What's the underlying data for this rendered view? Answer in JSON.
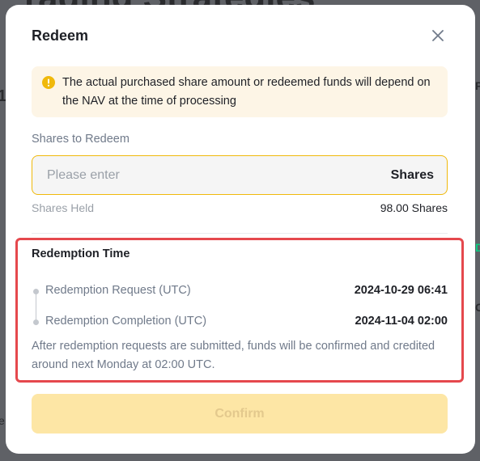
{
  "background": {
    "title_fragment": "rading Strategies",
    "left_fragment": "1",
    "left_bottom_fragment": "e",
    "right_fragment_1": "P",
    "right_fragment_2": "D",
    "right_fragment_3": "C"
  },
  "modal": {
    "title": "Redeem",
    "close_icon": "close-icon",
    "notice": {
      "icon": "warning-icon",
      "text": "The actual purchased share amount or redeemed funds will depend on the NAV at the time of processing",
      "color": "#fdf5e6",
      "icon_color": "#f0b90b"
    },
    "shares_field": {
      "label": "Shares to Redeem",
      "placeholder": "Please enter",
      "value": "",
      "suffix": "Shares"
    },
    "shares_held": {
      "label": "Shares Held",
      "value": "98.00 Shares"
    },
    "redemption": {
      "title": "Redemption Time",
      "request_label": "Redemption Request (UTC)",
      "request_value": "2024-10-29 06:41",
      "completion_label": "Redemption Completion (UTC)",
      "completion_value": "2024-11-04 02:00",
      "info": "After redemption requests are submitted, funds will be confirmed and credited around next Monday at 02:00 UTC."
    },
    "confirm_label": "Confirm"
  },
  "colors": {
    "accent": "#f0b90b",
    "highlight_border": "#e5484d",
    "confirm_disabled_bg": "#fde6a5"
  }
}
